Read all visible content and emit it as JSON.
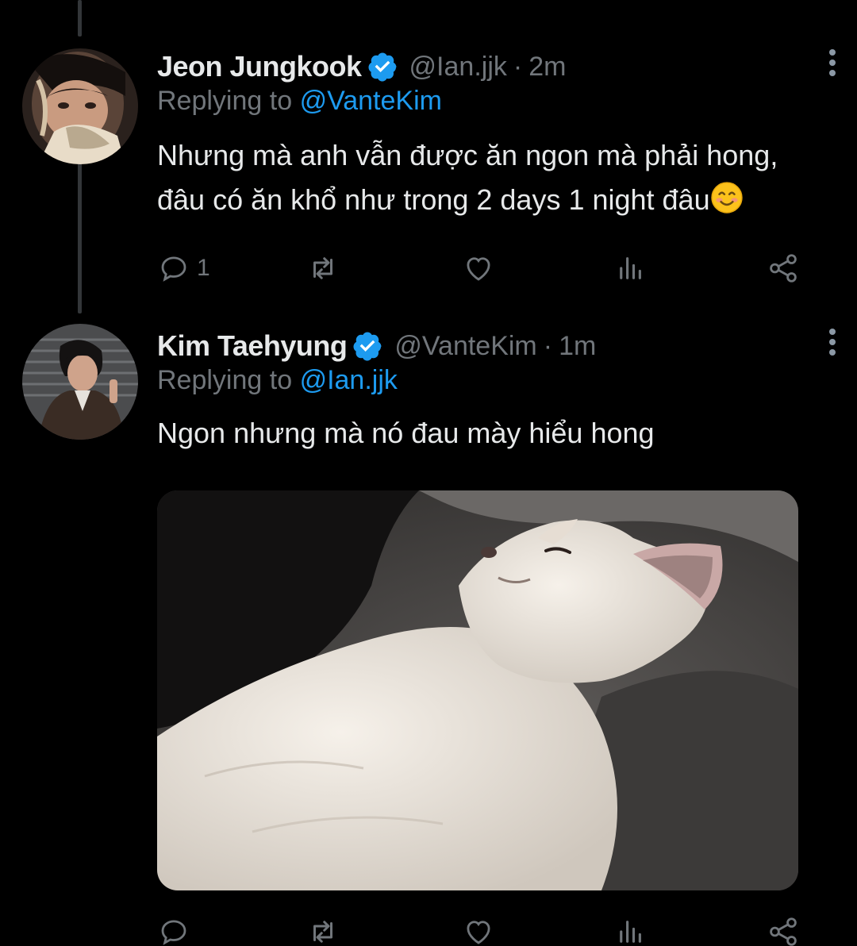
{
  "colors": {
    "background": "#000000",
    "text": "#e7e9ea",
    "muted": "#71767b",
    "accent": "#1d9bf0"
  },
  "tweets": [
    {
      "author": {
        "name": "Jeon Jungkook",
        "handle": "@Ian.jjk",
        "verified": true,
        "avatar_icon": "avatar-photo"
      },
      "time": "2m",
      "replying_label": "Replying to",
      "replying_to": "@VanteKim",
      "text_line1": "Nhưng mà anh vẫn được ăn ngon mà phải hong,",
      "text_line2": "đâu có ăn khổ như trong 2 days 1 night đâu",
      "emoji": "smiling-face-emoji",
      "actions": {
        "reply_count": "1",
        "retweet_count": "",
        "like_count": "",
        "views_count": ""
      }
    },
    {
      "author": {
        "name": "Kim Taehyung",
        "handle": "@VanteKim",
        "verified": true,
        "avatar_icon": "avatar-photo"
      },
      "time": "1m",
      "replying_label": "Replying to",
      "replying_to": "@Ian.jjk",
      "text_line1": "Ngon nhưng mà nó đau mày hiểu hong",
      "media": "white-cat-photo",
      "actions": {
        "reply_count": "",
        "retweet_count": "",
        "like_count": "",
        "views_count": ""
      }
    }
  ],
  "separator": "·"
}
